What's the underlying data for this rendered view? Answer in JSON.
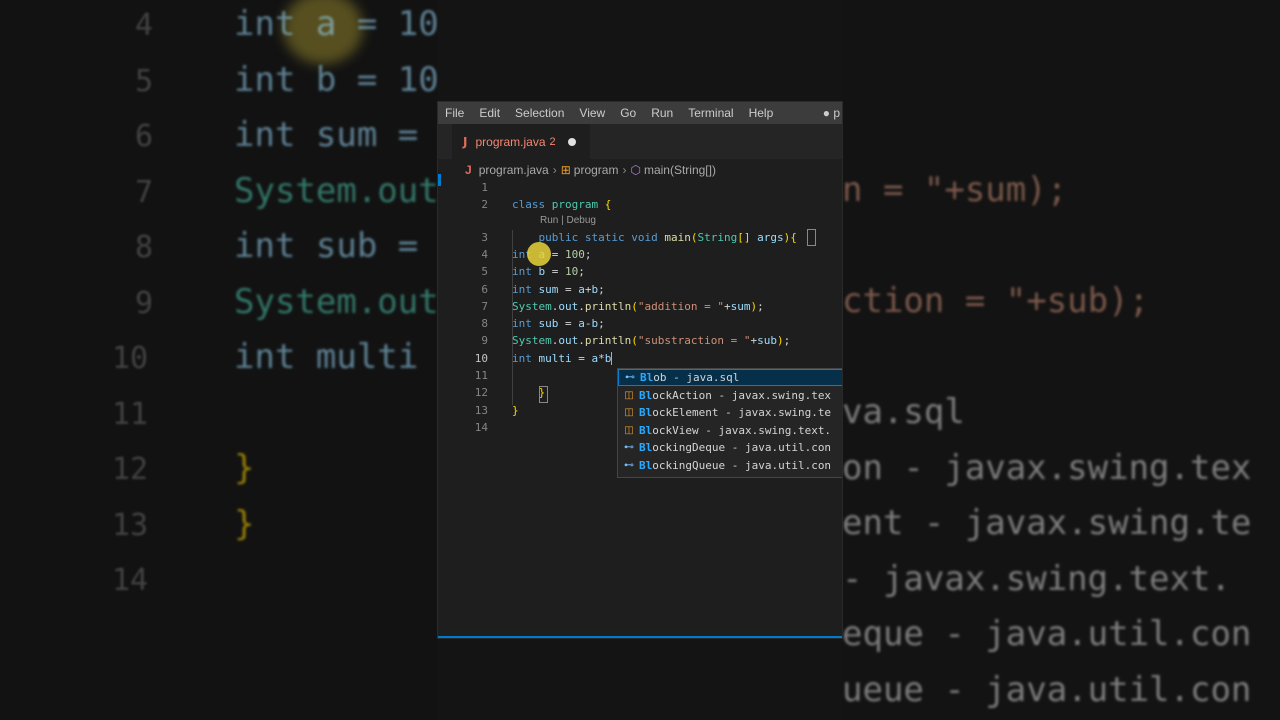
{
  "background": {
    "left_line_numbers": [
      "4",
      "5",
      "6",
      "7",
      "8",
      "9",
      "10",
      "11",
      "12",
      "13",
      "14"
    ],
    "left_lines": [
      "int a = 10",
      "int b = 10",
      "int sum =",
      "System.out",
      "int sub =",
      "System.out",
      "int multi",
      "",
      "}",
      "}",
      ""
    ],
    "right_lines": [
      "n = \"+sum);",
      "",
      "ction = \"+sub);",
      "",
      "va.sql",
      "on - javax.swing.tex",
      "ent - javax.swing.te",
      "- javax.swing.text.",
      "eque - java.util.con",
      "ueue - java.util.con"
    ]
  },
  "menubar": {
    "items": [
      "File",
      "Edit",
      "Selection",
      "View",
      "Go",
      "Run",
      "Terminal",
      "Help"
    ],
    "dirty_indicator": "● p"
  },
  "tab": {
    "icon": "J",
    "label": "program.java",
    "problems": "2",
    "modified_icon": "circle-icon"
  },
  "breadcrumb": {
    "file": "program.java",
    "class": "program",
    "method": "main(String[])"
  },
  "editor": {
    "line_numbers": [
      "1",
      "2",
      "3",
      "4",
      "5",
      "6",
      "7",
      "8",
      "9",
      "10",
      "11",
      "12",
      "13",
      "14"
    ],
    "active_line": "10",
    "codelens": "Run | Debug",
    "lines": [
      "",
      "class program {",
      "    public static void main(String[] args){",
      "int a = 100;",
      "int b = 10;",
      "int sum = a+b;",
      "System.out.println(\"addition = \"+sum);",
      "int sub = a-b;",
      "System.out.println(\"substraction = \"+sub);",
      "int multi = a*b",
      "",
      "    }",
      "}",
      ""
    ]
  },
  "suggestions": [
    {
      "icon": "field-icon",
      "match": "Bl",
      "rest": "ob - java.sql",
      "selected": true
    },
    {
      "icon": "class-icon",
      "match": "Bl",
      "rest": "ockAction - javax.swing.tex",
      "selected": false
    },
    {
      "icon": "class-icon",
      "match": "Bl",
      "rest": "ockElement - javax.swing.te",
      "selected": false
    },
    {
      "icon": "class-icon",
      "match": "Bl",
      "rest": "ockView - javax.swing.text.",
      "selected": false
    },
    {
      "icon": "field-icon",
      "match": "Bl",
      "rest": "ockingDeque - java.util.con",
      "selected": false
    },
    {
      "icon": "field-icon",
      "match": "Bl",
      "rest": "ockingQueue - java.util.con",
      "selected": false
    }
  ],
  "colors": {
    "accent": "#007acc",
    "keyword": "#569cd6",
    "type": "#4ec9b0",
    "function": "#dcdcaa",
    "string": "#ce9178",
    "number": "#b5cea8",
    "error_tab": "#f48771"
  }
}
